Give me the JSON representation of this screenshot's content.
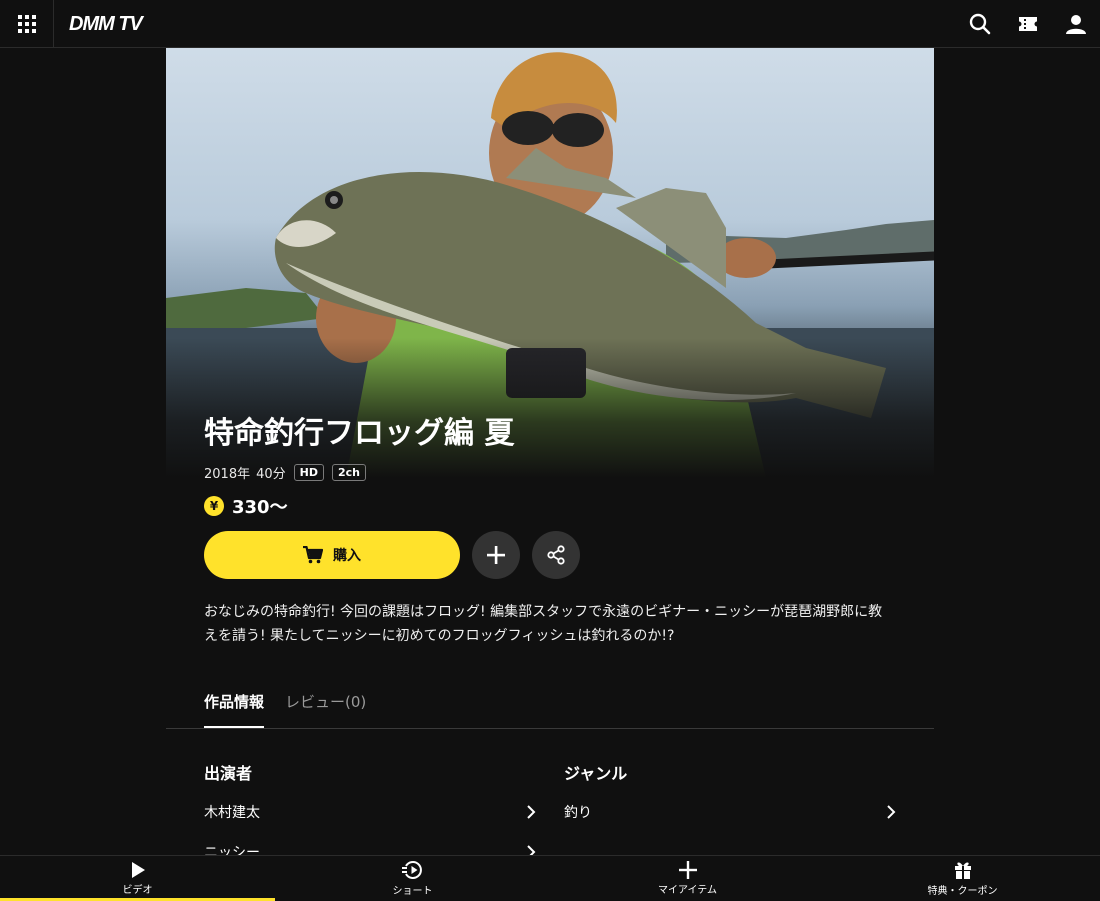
{
  "header": {
    "logo_text": "DMM TV",
    "icons": {
      "apps": "grid-icon",
      "search": "search-icon",
      "ticket": "ticket-icon",
      "account": "user-icon"
    }
  },
  "content": {
    "title": "特命釣行フロッグ編 夏",
    "meta": {
      "year": "2018年",
      "duration": "40分",
      "tag_hd": "HD",
      "tag_audio": "2ch"
    },
    "price": {
      "currency_symbol": "¥",
      "text": "330〜"
    },
    "buy_button_label": "購入",
    "description": "おなじみの特命釣行! 今回の課題はフロッグ! 編集部スタッフで永遠のビギナー・ニッシーが琵琶湖野郎に教えを請う! 果たしてニッシーに初めてのフロッグフィッシュは釣れるのか!?"
  },
  "tabs": [
    {
      "label": "作品情報",
      "active": true
    },
    {
      "label": "レビュー(0)",
      "active": false
    }
  ],
  "info": {
    "cast_heading": "出演者",
    "cast": [
      "木村建太",
      "ニッシー"
    ],
    "genre_heading": "ジャンル",
    "genres": [
      "釣り"
    ]
  },
  "bottom_nav": [
    {
      "label": "ビデオ",
      "icon": "play-icon",
      "active": true
    },
    {
      "label": "ショート",
      "icon": "short-play-icon",
      "active": false
    },
    {
      "label": "マイアイテム",
      "icon": "plus-icon",
      "active": false
    },
    {
      "label": "特典・クーポン",
      "icon": "gift-icon",
      "active": false
    }
  ],
  "colors": {
    "accent": "#ffe22b",
    "background": "#101010",
    "button_dark": "#333333"
  }
}
